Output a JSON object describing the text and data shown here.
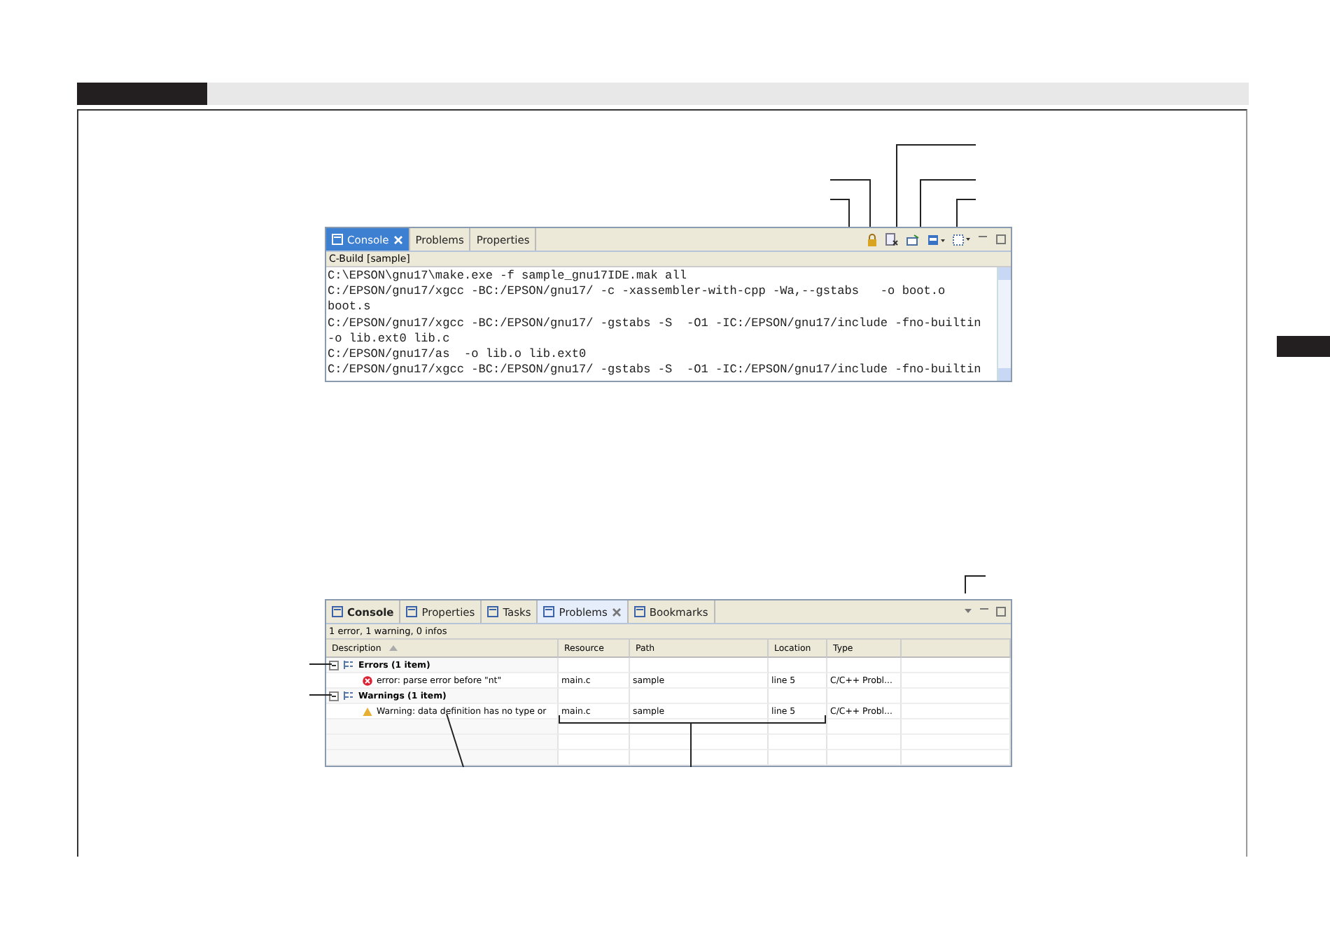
{
  "console_view": {
    "tabs": [
      {
        "label": "Console",
        "selected": true
      },
      {
        "label": "Problems",
        "selected": false
      },
      {
        "label": "Properties",
        "selected": false
      }
    ],
    "subtitle": "C-Build [sample]",
    "lines": [
      "C:\\EPSON\\gnu17\\make.exe -f sample_gnu17IDE.mak all",
      "C:/EPSON/gnu17/xgcc -BC:/EPSON/gnu17/ -c -xassembler-with-cpp -Wa,--gstabs   -o boot.o",
      "boot.s",
      "C:/EPSON/gnu17/xgcc -BC:/EPSON/gnu17/ -gstabs -S  -O1 -IC:/EPSON/gnu17/include -fno-builtin",
      "-o lib.ext0 lib.c",
      "C:/EPSON/gnu17/as  -o lib.o lib.ext0",
      "C:/EPSON/gnu17/xgcc -BC:/EPSON/gnu17/ -gstabs -S  -O1 -IC:/EPSON/gnu17/include -fno-builtin"
    ]
  },
  "problems_view": {
    "tabs": [
      {
        "label": "Console",
        "selected": false
      },
      {
        "label": "Properties",
        "selected": false
      },
      {
        "label": "Tasks",
        "selected": false
      },
      {
        "label": "Problems",
        "selected": true
      },
      {
        "label": "Bookmarks",
        "selected": false
      }
    ],
    "summary": "1 error, 1 warning, 0 infos",
    "columns": [
      "Description",
      "Resource",
      "Path",
      "Location",
      "Type"
    ],
    "groups": [
      {
        "label": "Errors (1 item)",
        "expanded": true,
        "children": [
          {
            "kind": "error",
            "description": "error: parse error before \"nt\"",
            "resource": "main.c",
            "path": "sample",
            "location": "line 5",
            "type": "C/C++ Probl..."
          }
        ]
      },
      {
        "label": "Warnings (1 item)",
        "expanded": true,
        "children": [
          {
            "kind": "warning",
            "description": "Warning: data definition has no type or",
            "resource": "main.c",
            "path": "sample",
            "location": "line 5",
            "type": "C/C++ Probl..."
          }
        ]
      }
    ]
  }
}
